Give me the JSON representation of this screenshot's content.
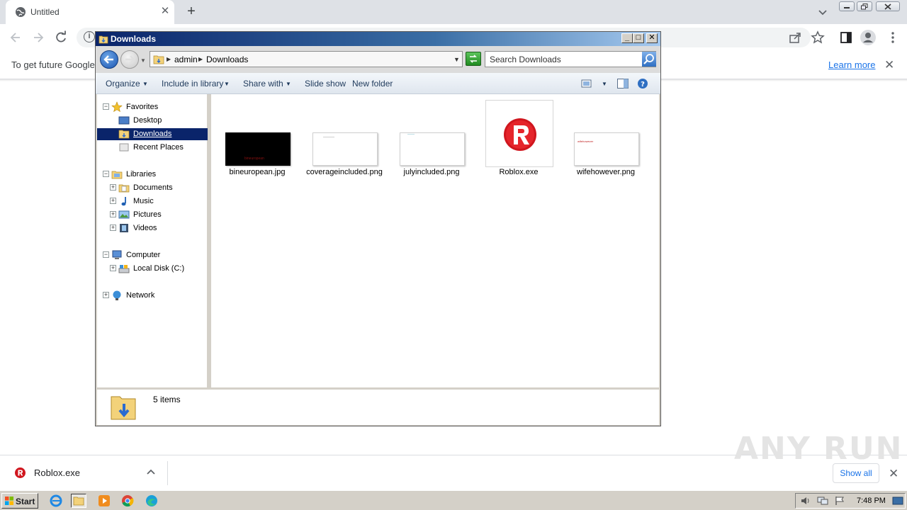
{
  "browser": {
    "tab_title": "Untitled",
    "infobar_message": "To get future Google",
    "infobar_link": "Learn more"
  },
  "explorer": {
    "title": "Downloads",
    "breadcrumb": [
      "admin",
      "Downloads"
    ],
    "search_placeholder": "Search Downloads",
    "commands": {
      "organize": "Organize",
      "include_in_library": "Include in library",
      "share_with": "Share with",
      "slide_show": "Slide show",
      "new_folder": "New folder"
    },
    "nav": {
      "favorites": "Favorites",
      "desktop": "Desktop",
      "downloads": "Downloads",
      "recent_places": "Recent Places",
      "libraries": "Libraries",
      "documents": "Documents",
      "music": "Music",
      "pictures": "Pictures",
      "videos": "Videos",
      "computer": "Computer",
      "local_disk": "Local Disk (C:)",
      "network": "Network"
    },
    "files": [
      {
        "name": "bineuropean.jpg",
        "thumb_style": "dark",
        "thumb_text": "bineuropean"
      },
      {
        "name": "coverageincluded.png",
        "thumb_style": "light",
        "thumb_text": ""
      },
      {
        "name": "julyincluded.png",
        "thumb_style": "light",
        "thumb_text": ""
      },
      {
        "name": "Roblox.exe",
        "thumb_style": "app-icon",
        "thumb_text": ""
      },
      {
        "name": "wifehowever.png",
        "thumb_style": "light",
        "thumb_text": "wifehowever"
      }
    ],
    "status_count": "5 items"
  },
  "download_shelf": {
    "file_name": "Roblox.exe",
    "show_all": "Show all"
  },
  "watermark": "ANY RUN",
  "taskbar": {
    "start_label": "Start",
    "clock": "7:48 PM"
  },
  "colors": {
    "titlebar_start": "#0a246a",
    "selection": "#0a246a",
    "link_blue": "#1a73e8",
    "roblox_red": "#d0161e"
  }
}
